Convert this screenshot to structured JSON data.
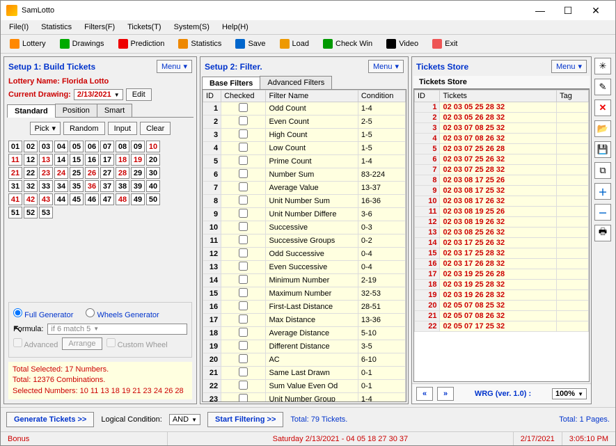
{
  "titlebar": {
    "title": "SamLotto"
  },
  "menubar": [
    "File(I)",
    "Statistics",
    "Filters(F)",
    "Tickets(T)",
    "System(S)",
    "Help(H)"
  ],
  "toolbar": [
    {
      "label": "Lottery",
      "color": "#f80"
    },
    {
      "label": "Drawings",
      "color": "#0a0"
    },
    {
      "label": "Prediction",
      "color": "#e00"
    },
    {
      "label": "Statistics",
      "color": "#e80"
    },
    {
      "label": "Save",
      "color": "#06c"
    },
    {
      "label": "Load",
      "color": "#e90"
    },
    {
      "label": "Check Win",
      "color": "#090"
    },
    {
      "label": "Video",
      "color": "#000"
    },
    {
      "label": "Exit",
      "color": "#e55"
    }
  ],
  "setup1": {
    "title": "Setup 1: Build  Tickets",
    "menu": "Menu",
    "lottery_label": "Lottery  Name: Florida Lotto",
    "drawing_label": "Current Drawing:",
    "drawing_value": "2/13/2021",
    "edit": "Edit",
    "tabs": [
      "Standard",
      "Position",
      "Smart"
    ],
    "picker": {
      "pick": "Pick",
      "random": "Random",
      "input": "Input",
      "clear": "Clear"
    },
    "selected": [
      10,
      11,
      13,
      18,
      19,
      21,
      23,
      24,
      26,
      28,
      36,
      41,
      42,
      43,
      48
    ],
    "max": 53,
    "gen": {
      "full": "Full Generator",
      "wheels": "Wheels Generator",
      "formula_label": "Formula:",
      "formula_value": "if 6 match 5",
      "advanced": "Advanced",
      "arrange": "Arrange",
      "custom": "Custom Wheel"
    },
    "summary": {
      "l1": "Total Selected: 17 Numbers.",
      "l2": "Total: 12376 Combinations.",
      "l3": "Selected Numbers: 10 11 13 18 19 21 23 24 26 28"
    }
  },
  "setup2": {
    "title": "Setup 2: Filter.",
    "menu": "Menu",
    "tabs": [
      "Base Filters",
      "Advanced Filters"
    ],
    "cols": [
      "ID",
      "Checked",
      "Filter Name",
      "Condition"
    ],
    "rows": [
      {
        "id": 1,
        "name": "Odd Count",
        "cond": "1-4"
      },
      {
        "id": 2,
        "name": "Even Count",
        "cond": "2-5"
      },
      {
        "id": 3,
        "name": "High Count",
        "cond": "1-5"
      },
      {
        "id": 4,
        "name": "Low Count",
        "cond": "1-5"
      },
      {
        "id": 5,
        "name": "Prime Count",
        "cond": "1-4"
      },
      {
        "id": 6,
        "name": "Number Sum",
        "cond": "83-224"
      },
      {
        "id": 7,
        "name": "Average Value",
        "cond": "13-37"
      },
      {
        "id": 8,
        "name": "Unit Number Sum",
        "cond": "16-36"
      },
      {
        "id": 9,
        "name": "Unit Number Differe",
        "cond": "3-6"
      },
      {
        "id": 10,
        "name": "Successive",
        "cond": "0-3"
      },
      {
        "id": 11,
        "name": "Successive Groups",
        "cond": "0-2"
      },
      {
        "id": 12,
        "name": "Odd Successive",
        "cond": "0-4"
      },
      {
        "id": 13,
        "name": "Even Successive",
        "cond": "0-4"
      },
      {
        "id": 14,
        "name": "Minimum Number",
        "cond": "2-19"
      },
      {
        "id": 15,
        "name": "Maximum Number",
        "cond": "32-53"
      },
      {
        "id": 16,
        "name": "First-Last Distance",
        "cond": "28-51"
      },
      {
        "id": 17,
        "name": "Max Distance",
        "cond": "13-36"
      },
      {
        "id": 18,
        "name": "Average Distance",
        "cond": "5-10"
      },
      {
        "id": 19,
        "name": "Different Distance",
        "cond": "3-5"
      },
      {
        "id": 20,
        "name": "AC",
        "cond": "6-10"
      },
      {
        "id": 21,
        "name": "Same Last Drawn",
        "cond": "0-1"
      },
      {
        "id": 22,
        "name": "Sum Value Even Od",
        "cond": "0-1"
      },
      {
        "id": 23,
        "name": "Unit Number Group",
        "cond": "1-4"
      }
    ]
  },
  "store": {
    "title": "Tickets Store",
    "menu": "Menu",
    "sub": "Tickets Store",
    "cols": [
      "ID",
      "Tickets",
      "Tag"
    ],
    "rows": [
      {
        "id": 1,
        "t": "02 03 05 25 28 32"
      },
      {
        "id": 2,
        "t": "02 03 05 26 28 32"
      },
      {
        "id": 3,
        "t": "02 03 07 08 25 32"
      },
      {
        "id": 4,
        "t": "02 03 07 08 26 32"
      },
      {
        "id": 5,
        "t": "02 03 07 25 26 28"
      },
      {
        "id": 6,
        "t": "02 03 07 25 26 32"
      },
      {
        "id": 7,
        "t": "02 03 07 25 28 32"
      },
      {
        "id": 8,
        "t": "02 03 08 17 25 26"
      },
      {
        "id": 9,
        "t": "02 03 08 17 25 32"
      },
      {
        "id": 10,
        "t": "02 03 08 17 26 32"
      },
      {
        "id": 11,
        "t": "02 03 08 19 25 26"
      },
      {
        "id": 12,
        "t": "02 03 08 19 26 32"
      },
      {
        "id": 13,
        "t": "02 03 08 25 26 32"
      },
      {
        "id": 14,
        "t": "02 03 17 25 26 32"
      },
      {
        "id": 15,
        "t": "02 03 17 25 28 32"
      },
      {
        "id": 16,
        "t": "02 03 17 26 28 32"
      },
      {
        "id": 17,
        "t": "02 03 19 25 26 28"
      },
      {
        "id": 18,
        "t": "02 03 19 25 28 32"
      },
      {
        "id": 19,
        "t": "02 03 19 26 28 32"
      },
      {
        "id": 20,
        "t": "02 05 07 08 25 32"
      },
      {
        "id": 21,
        "t": "02 05 07 08 26 32"
      },
      {
        "id": 22,
        "t": "02 05 07 17 25 32"
      }
    ],
    "foot": {
      "wrg": "WRG (ver. 1.0) :",
      "pct": "100%"
    }
  },
  "footer": {
    "gen": "Generate Tickets >>",
    "cond_label": "Logical Condition:",
    "cond_val": "AND",
    "start": "Start Filtering >>",
    "total": "Total: 79 Tickets.",
    "pages": "Total: 1 Pages."
  },
  "status": {
    "bonus": "Bonus",
    "date": "Saturday 2/13/2021 - 04 05 18 27 30 37",
    "right1": "2/17/2021",
    "right2": "3:05:10 PM"
  }
}
